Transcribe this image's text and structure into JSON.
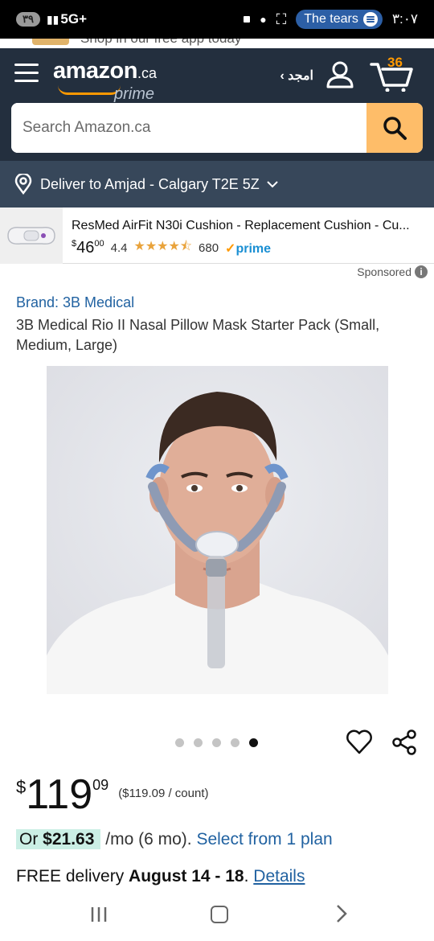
{
  "status_bar": {
    "battery": "٣٩",
    "network": "5G+",
    "media_title": "The tears",
    "time": "٣:٠٧"
  },
  "promo": {
    "text": "Shop in our free app today"
  },
  "header": {
    "logo_word": "amazon",
    "logo_tld": ".ca",
    "logo_prime": "prime",
    "account_name": "‹ امجد",
    "cart_count": "36"
  },
  "search": {
    "placeholder": "Search Amazon.ca"
  },
  "deliver": {
    "text": "Deliver to Amjad - Calgary T2E 5Z"
  },
  "sponsored_product": {
    "title": "ResMed AirFit N30i Cushion - Replacement Cushion - Cu...",
    "price_symbol": "$",
    "price_whole": "46",
    "price_fraction": "00",
    "rating": "4.4",
    "stars": "★★★★⯪",
    "review_count": "680",
    "prime_check": "✓",
    "prime_label": "prime"
  },
  "sponsored_label": "Sponsored",
  "product": {
    "brand": "Brand: 3B Medical",
    "title": "3B Medical Rio II Nasal Pillow Mask Starter Pack (Small, Medium, Large)",
    "image_count": 5,
    "active_image": 5,
    "price_symbol": "$",
    "price_whole": "119",
    "price_fraction": "09",
    "unit_price": "($119.09 / count)",
    "monthly_or": "Or",
    "monthly_amount": "$21.63",
    "monthly_terms": "/mo (6 mo).",
    "monthly_link": "Select from 1 plan",
    "delivery_prefix": "FREE delivery",
    "delivery_dates": "August 14 - 18",
    "delivery_sep": ".",
    "delivery_link": "Details"
  },
  "colors": {
    "header_bg": "#232f3e",
    "deliver_bg": "#37475a",
    "accent_orange": "#ff9900",
    "search_button": "#febd69",
    "link_blue": "#2162a1",
    "star_color": "#e9a33b",
    "prime_blue": "#1a8fd3"
  }
}
